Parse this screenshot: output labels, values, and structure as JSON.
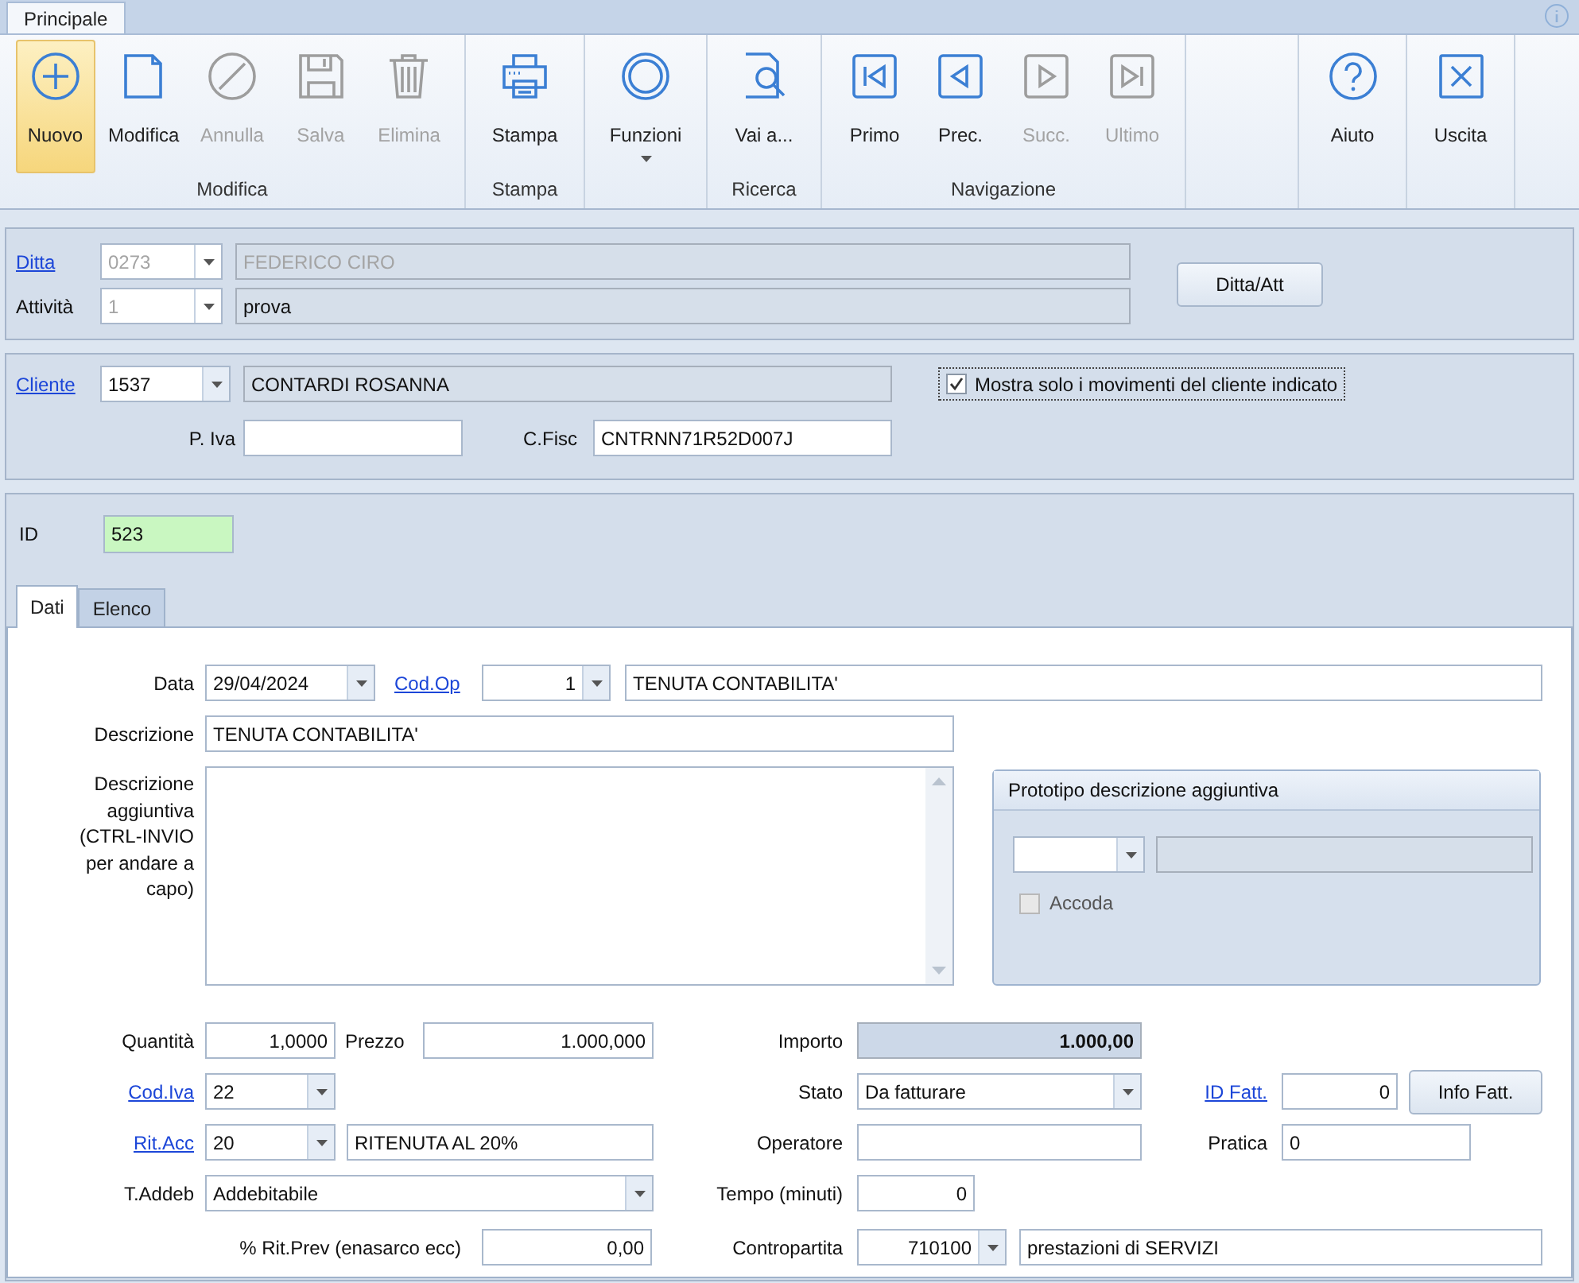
{
  "ribbon_tabs": [
    {
      "label": "Principale",
      "selected": true
    }
  ],
  "ribbon_groups": [
    {
      "label": "Modifica",
      "buttons": [
        {
          "kind": "plus",
          "label": "Nuovo",
          "selected": true,
          "disabled": false,
          "dropdown": false
        },
        {
          "kind": "edit",
          "label": "Modifica",
          "selected": false,
          "disabled": false,
          "dropdown": false
        },
        {
          "kind": "cancel",
          "label": "Annulla",
          "selected": false,
          "disabled": true,
          "dropdown": false
        },
        {
          "kind": "save",
          "label": "Salva",
          "selected": false,
          "disabled": true,
          "dropdown": false
        },
        {
          "kind": "delete",
          "label": "Elimina",
          "selected": false,
          "disabled": true,
          "dropdown": false
        }
      ]
    },
    {
      "label": "Stampa",
      "buttons": [
        {
          "kind": "print",
          "label": "Stampa",
          "selected": false,
          "disabled": false,
          "dropdown": false
        }
      ]
    },
    {
      "buttons": [
        {
          "kind": "functions",
          "label": "Funzioni",
          "selected": false,
          "disabled": false,
          "dropdown": true
        }
      ]
    },
    {
      "label": "Ricerca",
      "buttons": [
        {
          "kind": "search",
          "label": "Vai a...",
          "selected": false,
          "disabled": false,
          "dropdown": false
        }
      ]
    },
    {
      "label": "Navigazione",
      "buttons": [
        {
          "kind": "first",
          "label": "Primo",
          "selected": false,
          "disabled": false,
          "dropdown": false
        },
        {
          "kind": "prev",
          "label": "Prec.",
          "selected": false,
          "disabled": false,
          "dropdown": false
        },
        {
          "kind": "next",
          "label": "Succ.",
          "selected": false,
          "disabled": true,
          "dropdown": false
        },
        {
          "kind": "last",
          "label": "Ultimo",
          "selected": false,
          "disabled": true,
          "dropdown": false
        }
      ]
    },
    {
      "buttons": [
        {
          "kind": "help",
          "label": "Aiuto",
          "selected": false,
          "disabled": false,
          "dropdown": false
        }
      ]
    },
    {
      "buttons": [
        {
          "kind": "exit",
          "label": "Uscita",
          "selected": false,
          "disabled": false,
          "dropdown": false
        }
      ]
    }
  ],
  "company": {
    "ditta_link": "Ditta",
    "ditta_code": "0273",
    "ditta_name": "FEDERICO CIRO",
    "attivita_label": "Attività",
    "attivita_code": "1",
    "attivita_name": "prova",
    "disabled": true,
    "button": "Ditta/Att"
  },
  "customer": {
    "link": "Cliente",
    "code": "1537",
    "name": "CONTARDI ROSANNA",
    "filter": {
      "label": "Mostra solo i movimenti del cliente indicato",
      "checked": true
    },
    "piva_label": "P. Iva",
    "cf_label": "C.Fisc",
    "cf_value": "CNTRNN71R52D007J"
  },
  "record": {
    "id_label": "ID",
    "id_value": "523"
  },
  "tabs": [
    {
      "label": "Dati",
      "selected": true
    },
    {
      "label": "Elenco",
      "selected": false
    }
  ],
  "detail_rows": [
    [
      {
        "kind": "label",
        "text": "Data"
      },
      {
        "kind": "combo",
        "value": "29/04/2024"
      },
      {
        "kind": "link",
        "text": "Cod.Op"
      },
      {
        "kind": "combo",
        "value": "1"
      },
      {
        "kind": "field",
        "value": "TENUTA CONTABILITA'"
      }
    ],
    [
      {
        "kind": "label",
        "text": "Descrizione"
      },
      {
        "kind": "field",
        "value": "TENUTA CONTABILITA'"
      }
    ],
    [
      {
        "kind": "label",
        "text": "Quantità"
      },
      {
        "kind": "field",
        "value": "1,0000"
      },
      {
        "kind": "label",
        "text": "Prezzo"
      },
      {
        "kind": "field",
        "value": "1.000,000"
      },
      {
        "kind": "label",
        "text": "Importo"
      },
      {
        "kind": "total",
        "value": "1.000,00"
      }
    ],
    [
      {
        "kind": "link",
        "text": "Cod.Iva"
      },
      {
        "kind": "combo",
        "value": "22"
      },
      {
        "kind": "label",
        "text": "Stato"
      },
      {
        "kind": "combo",
        "value": "Da fatturare"
      },
      {
        "kind": "link",
        "text": "ID Fatt."
      },
      {
        "kind": "field",
        "value": "0"
      },
      {
        "kind": "button",
        "text": "Info Fatt."
      }
    ],
    [
      {
        "kind": "link",
        "text": "Rit.Acc"
      },
      {
        "kind": "combo",
        "value": "20"
      },
      {
        "kind": "field",
        "value": "RITENUTA AL 20%"
      },
      {
        "kind": "label",
        "text": "Operatore"
      },
      {
        "kind": "field"
      },
      {
        "kind": "label",
        "text": "Pratica"
      },
      {
        "kind": "field",
        "value": "0"
      }
    ],
    [
      {
        "kind": "label",
        "text": "T.Addeb"
      },
      {
        "kind": "combo",
        "value": "Addebitabile"
      },
      {
        "kind": "label",
        "text": "Tempo (minuti)"
      },
      {
        "kind": "field",
        "value": "0"
      }
    ],
    [
      {
        "kind": "label",
        "text": "% Rit.Prev (enasarco ecc)"
      },
      {
        "kind": "field",
        "value": "0,00"
      },
      {
        "kind": "label",
        "text": "Contropartita"
      },
      {
        "kind": "combo",
        "value": "710100"
      },
      {
        "kind": "field",
        "value": "prestazioni di SERVIZI"
      }
    ]
  ],
  "extra_description": {
    "label": "Descrizione aggiuntiva (CTRL-INVIO per andare a capo)"
  },
  "prototype_group": {
    "title": "Prototipo descrizione aggiuntiva",
    "accoda": {
      "label": "Accoda",
      "checked": false,
      "disabled": true
    }
  }
}
